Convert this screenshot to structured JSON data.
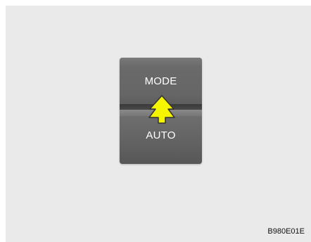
{
  "switch": {
    "top_label": "MODE",
    "bottom_label": "AUTO",
    "arrow_color": "#f5f500",
    "arrow_outline": "#333333"
  },
  "caption": "B980E01E"
}
